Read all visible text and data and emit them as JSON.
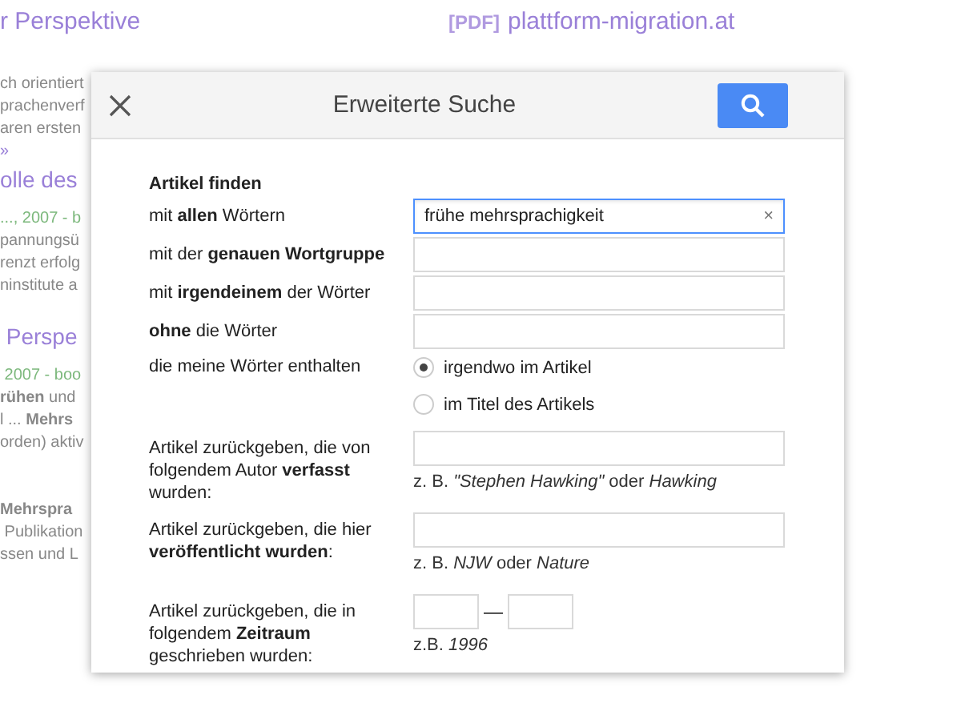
{
  "background": {
    "source": {
      "tag": "[PDF]",
      "domain": "plattform-migration.at"
    },
    "lines": [
      {
        "kind": "title",
        "text": "r Perspektive"
      },
      {
        "kind": "gap"
      },
      {
        "kind": "snippet",
        "text": "ch orientiert"
      },
      {
        "kind": "snippet",
        "text": "prachenverf"
      },
      {
        "kind": "snippet",
        "text": "aren ersten"
      },
      {
        "kind": "more",
        "text": "»"
      },
      {
        "kind": "title",
        "text": "olle des"
      },
      {
        "kind": "meta",
        "text": "..., 2007 - b"
      },
      {
        "kind": "snippet",
        "text": "pannungsü"
      },
      {
        "kind": "snippet",
        "text": "renzt erfolg"
      },
      {
        "kind": "snippet",
        "text": "ninstitute a"
      },
      {
        "kind": "gap"
      },
      {
        "kind": "title",
        "text": " Perspe"
      },
      {
        "kind": "meta",
        "text": " 2007 - boo"
      },
      {
        "kind": "snippet",
        "text": "**rühen** und"
      },
      {
        "kind": "snippet",
        "text": "l ... **Mehrs**"
      },
      {
        "kind": "snippet",
        "text": "orden) aktiv"
      },
      {
        "kind": "gap"
      },
      {
        "kind": "gap"
      },
      {
        "kind": "strong",
        "text": "Mehrspra"
      },
      {
        "kind": "snippet",
        "text": " Publikation"
      },
      {
        "kind": "snippet",
        "text": "ssen und L"
      }
    ]
  },
  "dialog": {
    "title": "Erweiterte Suche",
    "rows": [
      {
        "kind": "heading",
        "label": "Artikel finden"
      },
      {
        "kind": "text",
        "label": "mit **allen** Wörtern",
        "value": "frühe mehrsprachigkeit",
        "clear": "×"
      },
      {
        "kind": "text",
        "label": "mit der **genauen Wortgruppe**"
      },
      {
        "kind": "text",
        "label": "mit **irgendeinem** der Wörter"
      },
      {
        "kind": "text",
        "label": "**ohne** die Wörter"
      },
      {
        "kind": "radio",
        "label": "die meine Wörter enthalten",
        "options": [
          {
            "label": "irgendwo im Artikel",
            "selected": true
          },
          {
            "label": "im Titel des Artikels",
            "selected": false
          }
        ]
      },
      {
        "kind": "hinted",
        "label": "Artikel zurückgeben, die von folgendem Autor **verfasst** wurden:",
        "hint": "z. B. *\"Stephen Hawking\"* oder *Hawking*"
      },
      {
        "kind": "hinted",
        "label": "Artikel zurückgeben, die hier **veröffentlicht wurden**:",
        "hint": "z. B. *NJW* oder *Nature*"
      },
      {
        "kind": "range",
        "label": "Artikel zurückgeben, die in folgendem **Zeitraum** geschrieben wurden:",
        "separator": "—",
        "hint": "z.B. *1996*"
      }
    ]
  }
}
